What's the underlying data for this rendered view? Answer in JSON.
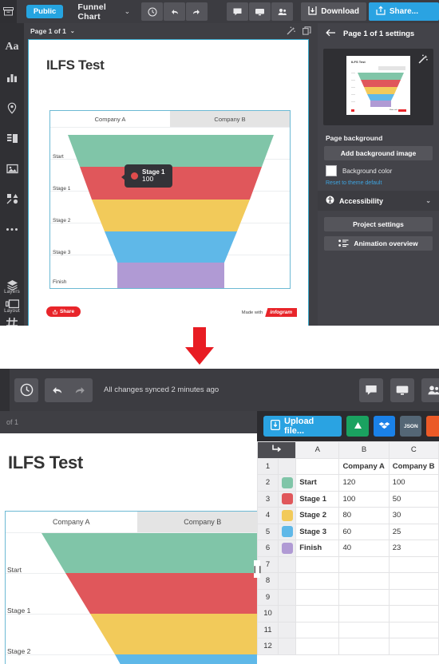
{
  "top": {
    "toolbar": {
      "home_icon": "archive-icon",
      "public_label": "Public",
      "doc_title": "Funnel Chart",
      "caret": "⌄",
      "history_icon": "clock-icon",
      "undo_icon": "undo-icon",
      "redo_icon": "redo-icon",
      "comment_icon": "comment-icon",
      "present_icon": "monitor-icon",
      "collaborators_icon": "people-icon",
      "download_label": "Download",
      "download_icon": "download-icon",
      "share_label": "Share...",
      "share_icon": "share-icon"
    },
    "rail": [
      {
        "name": "text-tool",
        "glyph": "Aa",
        "label": ""
      },
      {
        "name": "chart-tool",
        "glyph": "chart-icon",
        "label": ""
      },
      {
        "name": "map-tool",
        "glyph": "map-pin-icon",
        "label": ""
      },
      {
        "name": "card-tool",
        "glyph": "card-icon",
        "label": ""
      },
      {
        "name": "image-tool",
        "glyph": "image-icon",
        "label": ""
      },
      {
        "name": "shapes-tool",
        "glyph": "shapes-icon",
        "label": ""
      },
      {
        "name": "more-tool",
        "glyph": "ellipsis-icon",
        "label": ""
      }
    ],
    "rail_bottom": [
      {
        "name": "layers-tool",
        "glyph": "layers-icon",
        "label": "Layers"
      },
      {
        "name": "layout-tool",
        "glyph": "layout-icon",
        "label": "Layout"
      },
      {
        "name": "grid-tool",
        "glyph": "grid-icon",
        "label": "Grid"
      }
    ],
    "page_bar": {
      "label": "Page 1 of 1",
      "caret": "⌄",
      "wand_icon": "magic-wand-icon",
      "duplicate_icon": "duplicate-icon"
    },
    "slide": {
      "title": "ILFS Test",
      "share_chip": "Share",
      "made_with": "Made with",
      "brand": "infogram"
    },
    "tooltip": {
      "title": "Stage 1",
      "value": "100"
    },
    "settings": {
      "back_icon": "arrow-left-icon",
      "heading": "Page 1 of 1 settings",
      "wand_icon": "magic-wand-icon",
      "section_title": "Page background",
      "add_bg_label": "Add background image",
      "bg_color_label": "Background color",
      "reset_link": "Reset to theme default",
      "accessibility_label": "Accessibility",
      "accessibility_icon": "accessibility-icon",
      "accessibility_caret": "⌄",
      "project_settings_label": "Project settings",
      "animation_label": "Animation overview",
      "animation_icon": "list-icon",
      "thumb_title": "ILFS Test"
    }
  },
  "bottom": {
    "toolbar": {
      "history_icon": "clock-icon",
      "undo_icon": "undo-icon",
      "redo_icon": "redo-icon",
      "sync_status": "All changes synced 2 minutes ago",
      "comment_icon": "comment-icon",
      "present_icon": "monitor-icon",
      "collaborators_icon": "people-icon"
    },
    "page_bar_label": "of 1",
    "slide_title": "ILFS Test",
    "sheet": {
      "upload_label": "Upload file...",
      "upload_icon": "upload-icon",
      "gdrive_label": "",
      "gdrive_icon": "google-drive-icon",
      "dropbox_label": "",
      "dropbox_icon": "dropbox-icon",
      "json_label": "JSON",
      "extra_label": "",
      "corner_icon": "wrap-arrow-icon",
      "col_headers": [
        "",
        "A",
        "B",
        "C"
      ],
      "rows": [
        {
          "num": "1",
          "color": "",
          "a": "",
          "b": "Company A",
          "c": "Company B",
          "header": true
        },
        {
          "num": "2",
          "color": "#80c5a8",
          "a": "Start",
          "b": "120",
          "c": "100",
          "header": false
        },
        {
          "num": "3",
          "color": "#e0575b",
          "a": "Stage 1",
          "b": "100",
          "c": "50",
          "header": false
        },
        {
          "num": "4",
          "color": "#f2ca5a",
          "a": "Stage 2",
          "b": "80",
          "c": "30",
          "header": false
        },
        {
          "num": "5",
          "color": "#5fb8e8",
          "a": "Stage 3",
          "b": "60",
          "c": "25",
          "header": false
        },
        {
          "num": "6",
          "color": "#b09ad4",
          "a": "Finish",
          "b": "40",
          "c": "23",
          "header": false
        },
        {
          "num": "7",
          "color": "",
          "a": "",
          "b": "",
          "c": "",
          "header": false
        },
        {
          "num": "8",
          "color": "",
          "a": "",
          "b": "",
          "c": "",
          "header": false
        },
        {
          "num": "9",
          "color": "",
          "a": "",
          "b": "",
          "c": "",
          "header": false
        },
        {
          "num": "10",
          "color": "",
          "a": "",
          "b": "",
          "c": "",
          "header": false
        },
        {
          "num": "11",
          "color": "",
          "a": "",
          "b": "",
          "c": "",
          "header": false
        },
        {
          "num": "12",
          "color": "",
          "a": "",
          "b": "",
          "c": "",
          "header": false
        }
      ]
    }
  },
  "chart_data": {
    "type": "funnel",
    "title": "ILFS Test",
    "tabs": [
      "Company A",
      "Company B"
    ],
    "active_tab": "Company A",
    "categories": [
      "Start",
      "Stage 1",
      "Stage 2",
      "Stage 3",
      "Finish"
    ],
    "series": [
      {
        "name": "Company A",
        "values": [
          120,
          100,
          80,
          60,
          40
        ]
      },
      {
        "name": "Company B",
        "values": [
          100,
          50,
          30,
          25,
          23
        ]
      }
    ],
    "colors": [
      "#80c5a8",
      "#e0575b",
      "#f2ca5a",
      "#5fb8e8",
      "#b09ad4"
    ],
    "xlabel": "",
    "ylabel": "",
    "grid": true,
    "legend": "none",
    "annotation": {
      "label": "Stage 1",
      "value": "100"
    }
  },
  "accents": {
    "brand_blue": "#2aa3e2",
    "brand_red": "#e8252a",
    "panel_dark": "#3c3c41",
    "rail_dark": "#303034",
    "arrow_red": "#e81c23"
  }
}
